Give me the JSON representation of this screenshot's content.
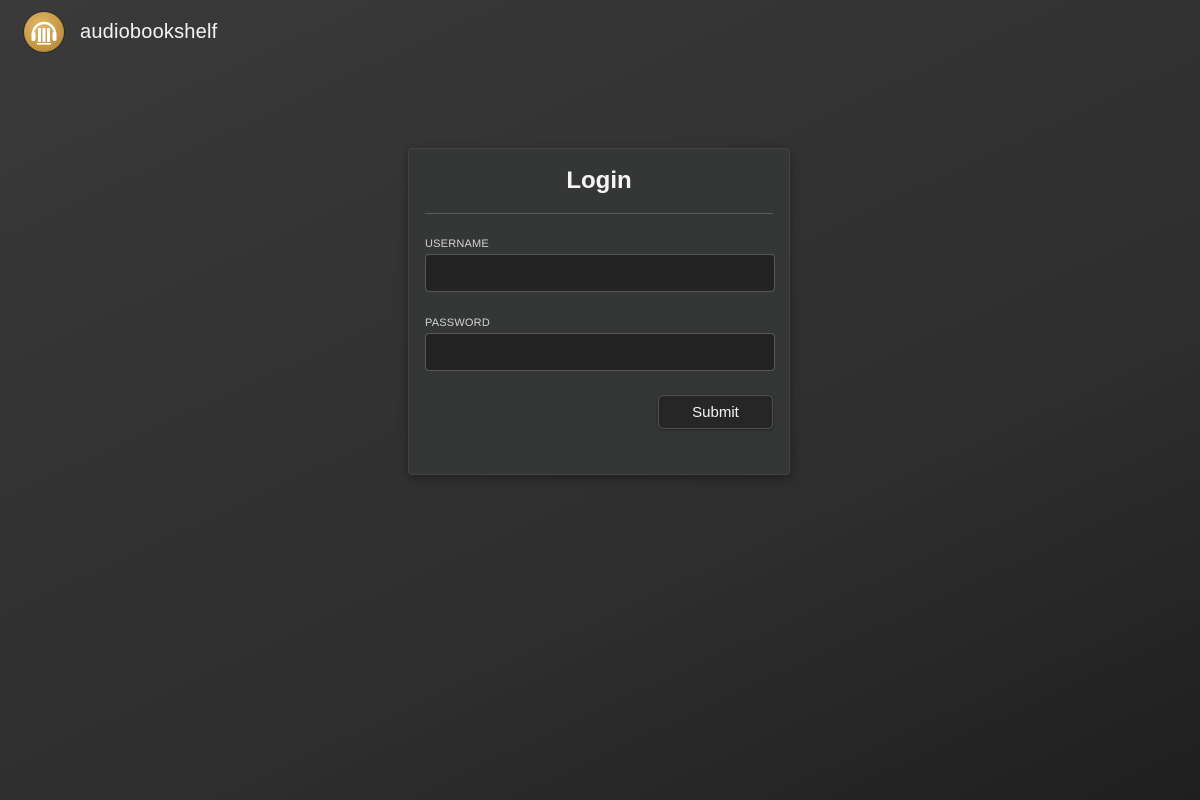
{
  "app": {
    "name": "audiobookshelf",
    "logo_icon": "audiobookshelf-logo-icon",
    "accent_color": "#c89a47"
  },
  "login": {
    "title": "Login",
    "username_label": "USERNAME",
    "username_value": "",
    "password_label": "PASSWORD",
    "password_value": "",
    "submit_label": "Submit"
  }
}
